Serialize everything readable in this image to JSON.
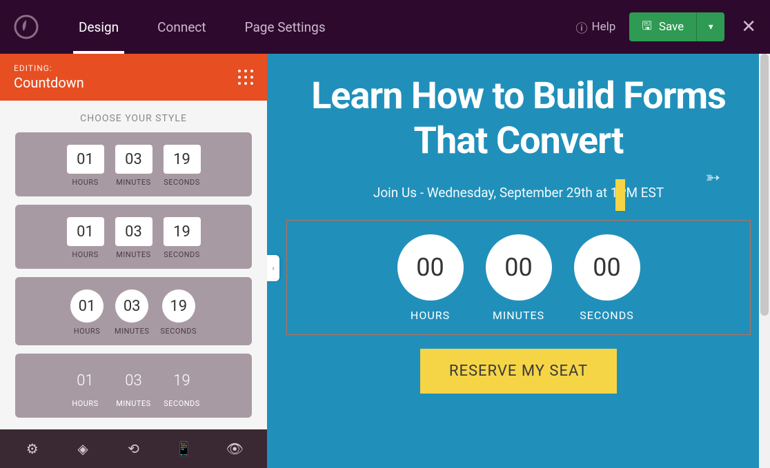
{
  "header": {
    "tabs": [
      "Design",
      "Connect",
      "Page Settings"
    ],
    "help_label": "Help",
    "save_label": "Save"
  },
  "sidebar": {
    "editing_label": "EDITING:",
    "editing_name": "Countdown",
    "choose_style_label": "CHOOSE YOUR STYLE",
    "styles": [
      {
        "type": "box",
        "units": [
          {
            "v": "01",
            "l": "HOURS"
          },
          {
            "v": "03",
            "l": "MINUTES"
          },
          {
            "v": "19",
            "l": "SECONDS"
          }
        ]
      },
      {
        "type": "flat",
        "units": [
          {
            "v": "01",
            "l": "HOURS"
          },
          {
            "v": "03",
            "l": "MINUTES"
          },
          {
            "v": "19",
            "l": "SECONDS"
          }
        ]
      },
      {
        "type": "round",
        "units": [
          {
            "v": "01",
            "l": "HOURS"
          },
          {
            "v": "03",
            "l": "MINUTES"
          },
          {
            "v": "19",
            "l": "SECONDS"
          }
        ]
      },
      {
        "type": "plain",
        "units": [
          {
            "v": "01",
            "l": "HOURS"
          },
          {
            "v": "03",
            "l": "MINUTES"
          },
          {
            "v": "19",
            "l": "SECONDS"
          }
        ]
      }
    ]
  },
  "canvas": {
    "headline": "Learn How to Build Forms That Convert",
    "subhead": "Join Us - Wednesday, September 29th at 1PM EST",
    "countdown": [
      {
        "v": "00",
        "l": "HOURS"
      },
      {
        "v": "00",
        "l": "MINUTES"
      },
      {
        "v": "00",
        "l": "SECONDS"
      }
    ],
    "cta_label": "RESERVE MY SEAT"
  },
  "icons": {
    "gear": "gear-icon",
    "layers": "layers-icon",
    "history": "history-icon",
    "mobile": "mobile-icon",
    "eye": "eye-icon"
  }
}
